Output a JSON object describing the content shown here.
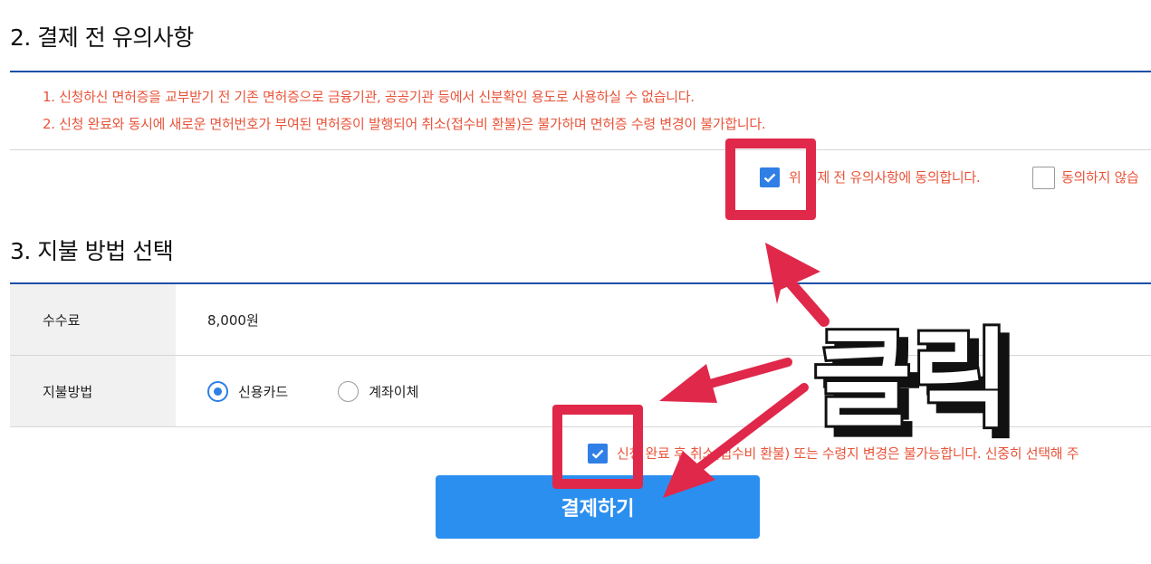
{
  "section2": {
    "title": "2. 결제 전 유의사항",
    "notices": [
      "1. 신청하신 면허증을 교부받기 전 기존 면허증으로 금융기관, 공공기관 등에서 신분확인 용도로 사용하실 수 없습니다.",
      "2. 신청 완료와 동시에 새로운 면허번호가 부여된 면허증이 발행되어 취소(접수비 환불)은 불가하며 면허증 수령 변경이 불가합니다."
    ],
    "agree": {
      "label": "위 결제 전 유의사항에 동의합니다.",
      "checked": true
    },
    "disagree": {
      "label": "동의하지 않습",
      "checked": false
    }
  },
  "section3": {
    "title": "3. 지불 방법 선택",
    "fee": {
      "label": "수수료",
      "value": "8,000원"
    },
    "method": {
      "label": "지불방법",
      "options": [
        {
          "label": "신용카드",
          "selected": true
        },
        {
          "label": "계좌이체",
          "selected": false
        }
      ]
    },
    "confirm": {
      "label": "신청 완료 후 취소(접수비 환불) 또는 수령지 변경은 불가능합니다. 신중히 선택해 주",
      "checked": true
    },
    "pay_button": "결제하기"
  },
  "annotation": {
    "text": "클릭",
    "highlight_color": "#e0284a"
  },
  "colors": {
    "accent_blue": "#2f7fe6",
    "button_blue": "#2b8ff0",
    "notice_red": "#e8543a",
    "rule_blue": "#1a4fa8"
  }
}
